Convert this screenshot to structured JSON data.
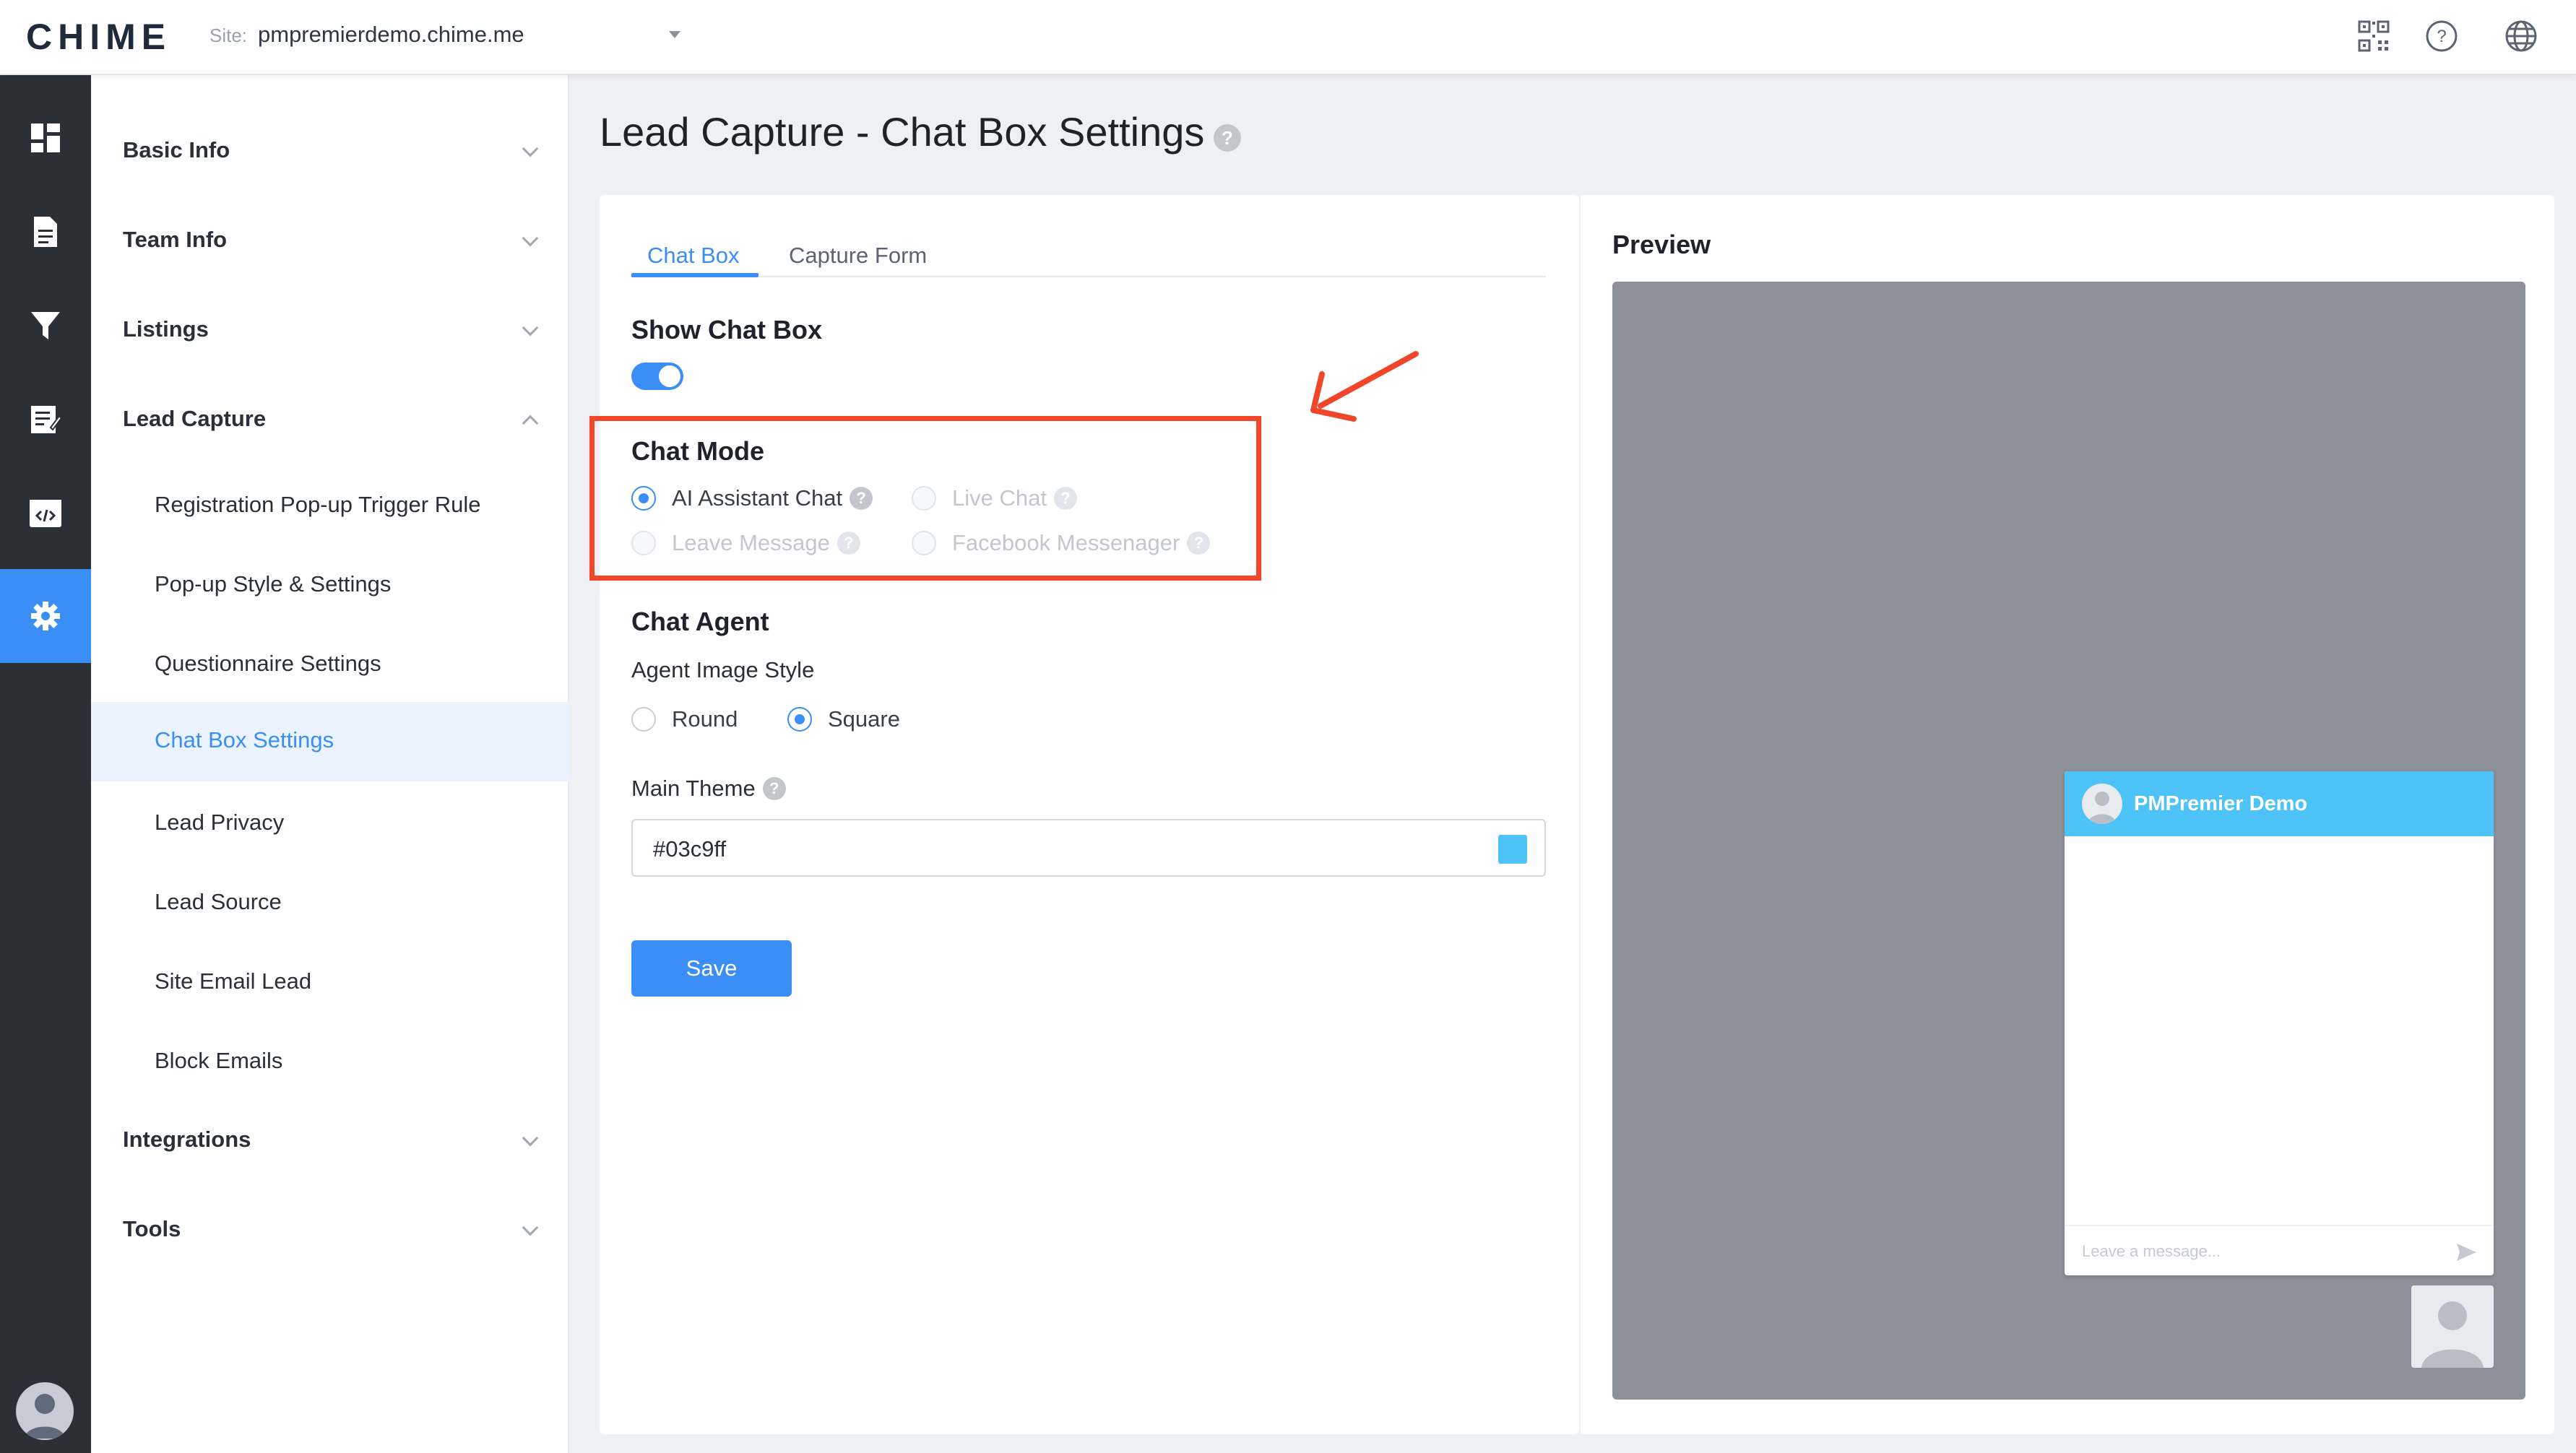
{
  "header": {
    "logo": "CHIME",
    "site_label": "Site:",
    "site_value": "pmpremierdemo.chime.me",
    "icons": [
      "qr-code-icon",
      "help-icon",
      "globe-icon"
    ]
  },
  "rail": {
    "items": [
      "dashboard-icon",
      "document-icon",
      "filter-icon",
      "notes-icon",
      "code-icon",
      "settings-icon"
    ],
    "active": "settings-icon"
  },
  "sidebar": {
    "groups": [
      {
        "label": "Basic Info",
        "expanded": false
      },
      {
        "label": "Team Info",
        "expanded": false
      },
      {
        "label": "Listings",
        "expanded": false
      },
      {
        "label": "Lead Capture",
        "expanded": true
      },
      {
        "label": "Integrations",
        "expanded": false
      },
      {
        "label": "Tools",
        "expanded": false
      }
    ],
    "lead_capture_items": [
      "Registration Pop-up Trigger Rule",
      "Pop-up Style & Settings",
      "Questionnaire Settings",
      "Chat Box Settings",
      "Lead Privacy",
      "Lead Source",
      "Site Email Lead",
      "Block Emails"
    ],
    "active_item": "Chat Box Settings"
  },
  "main": {
    "title": "Lead Capture - Chat Box Settings",
    "help": "?",
    "tabs": [
      {
        "label": "Chat Box",
        "active": true
      },
      {
        "label": "Capture Form",
        "active": false
      }
    ],
    "show_chat_box": {
      "title": "Show Chat Box",
      "enabled": true
    },
    "chat_mode": {
      "title": "Chat Mode",
      "options": [
        {
          "label": "AI Assistant Chat",
          "checked": true,
          "disabled": false
        },
        {
          "label": "Live Chat",
          "checked": false,
          "disabled": true
        },
        {
          "label": "Leave Message",
          "checked": false,
          "disabled": true
        },
        {
          "label": "Facebook Messenager",
          "checked": false,
          "disabled": true
        }
      ]
    },
    "chat_agent": {
      "title": "Chat Agent",
      "image_style_label": "Agent Image Style",
      "image_style_options": [
        {
          "label": "Round",
          "checked": false
        },
        {
          "label": "Square",
          "checked": true
        }
      ]
    },
    "main_theme": {
      "label": "Main Theme",
      "value": "#03c9ff",
      "swatch": "#4ec3f7"
    },
    "save_label": "Save"
  },
  "preview": {
    "title": "Preview",
    "chat_name": "PMPremier Demo",
    "input_placeholder": "Leave a message...",
    "header_color": "#4ec3f7"
  },
  "colors": {
    "accent": "#3a8ef6",
    "highlight": "#f2462b",
    "rail": "#2b2f36"
  }
}
